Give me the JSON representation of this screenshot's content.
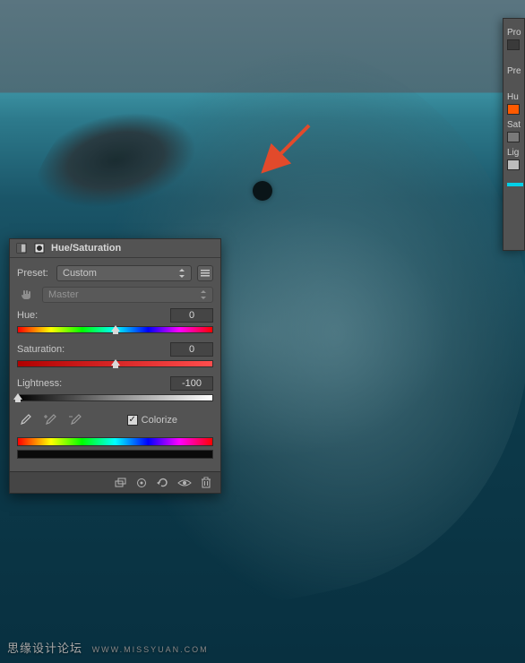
{
  "panel": {
    "title": "Hue/Saturation",
    "preset_label": "Preset:",
    "preset_value": "Custom",
    "channel_value": "Master",
    "sliders": {
      "hue": {
        "label": "Hue:",
        "value": "0",
        "pos": 50
      },
      "sat": {
        "label": "Saturation:",
        "value": "0",
        "pos": 50
      },
      "light": {
        "label": "Lightness:",
        "value": "-100",
        "pos": 0
      }
    },
    "colorize_label": "Colorize",
    "colorize_checked": true
  },
  "right_panel": {
    "labels": [
      "Pro",
      "Pre",
      "Hu",
      "Sat",
      "Lig"
    ]
  },
  "watermark": {
    "main": "思缘设计论坛",
    "sub": "WWW.MISSYUAN.COM"
  }
}
